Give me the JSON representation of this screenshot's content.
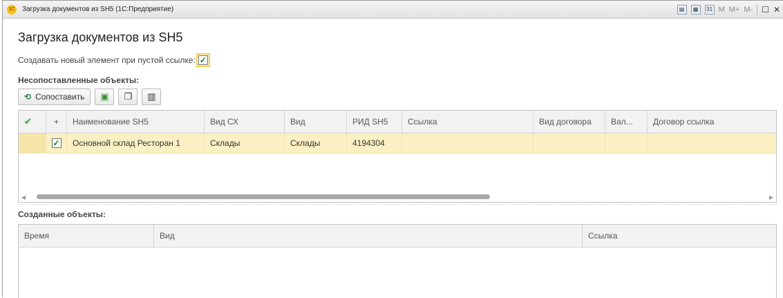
{
  "window": {
    "title": "Загрузка документов из SH5  (1С:Предприятие)",
    "mem_buttons": [
      "M",
      "M+",
      "M-"
    ],
    "calendar_day": "31"
  },
  "form": {
    "title": "Загрузка документов из SH5",
    "create_new_label": "Создавать новый элемент при пустой ссылке:",
    "create_new_checked": true
  },
  "unmatched": {
    "label": "Несопоставленные объекты:",
    "match_button": "Сопоставить",
    "columns": [
      "",
      "+",
      "Наименование SH5",
      "Вид СХ",
      "Вид",
      "РИД SH5",
      "Ссылка",
      "Вид договора",
      "Вал...",
      "Договор ссылка"
    ],
    "rows": [
      {
        "checked": true,
        "name": "Основной склад Ресторан 1",
        "vid_sx": "Склады",
        "vid": "Склады",
        "rid": "4194304",
        "ref": "",
        "contract_type": "",
        "currency": "",
        "contract_ref": ""
      }
    ],
    "scroll_position": 0.6
  },
  "created": {
    "label": "Созданные объекты:",
    "columns": [
      "Время",
      "Вид",
      "Ссылка"
    ]
  }
}
